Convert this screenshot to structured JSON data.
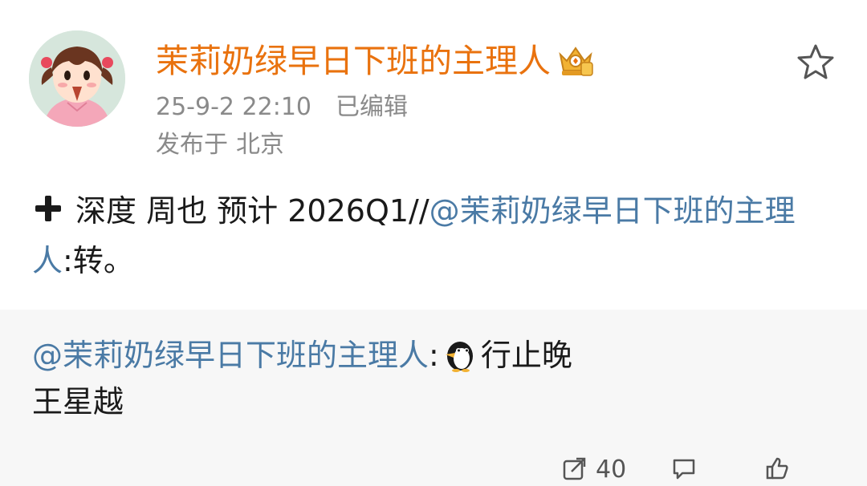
{
  "post": {
    "author": "茉莉奶绿早日下班的主理人",
    "timestamp": "25-9-2 22:10",
    "edited_label": "已编辑",
    "location_prefix": "发布于",
    "location": "北京",
    "body_text": "深度 周也  预计 2026Q1//",
    "body_mention": "@茉莉奶绿早日下班的主理人",
    "body_suffix": ":转。"
  },
  "repost": {
    "mention": "@茉莉奶绿早日下班的主理人",
    "colon": ":",
    "line1_text": "行止晚",
    "line2_text": "王星越"
  },
  "actions": {
    "repost_count": "40",
    "comment_count": "",
    "like_count": ""
  },
  "icons": {
    "plus": "heavy-plus-icon",
    "vip": "vip-crown-badge-icon",
    "star": "favorite-star-icon",
    "penguin": "penguin-emoji-icon",
    "repost": "repost-icon",
    "comment": "comment-icon",
    "like": "like-icon"
  },
  "colors": {
    "username": "#e9720e",
    "mention": "#4a7aa5",
    "meta": "#8a8a8a",
    "repost_bg": "#f7f7f7"
  }
}
